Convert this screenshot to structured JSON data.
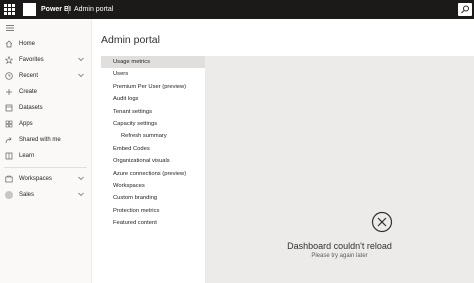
{
  "header": {
    "app_name": "Power BI",
    "breadcrumb": "Admin portal"
  },
  "nav": {
    "items": [
      {
        "label": "Home",
        "icon": "home-icon"
      },
      {
        "label": "Favorites",
        "icon": "star-icon",
        "chevron": true
      },
      {
        "label": "Recent",
        "icon": "clock-icon",
        "chevron": true
      },
      {
        "label": "Create",
        "icon": "plus-icon"
      },
      {
        "label": "Datasets",
        "icon": "database-icon"
      },
      {
        "label": "Apps",
        "icon": "apps-icon"
      },
      {
        "label": "Shared with me",
        "icon": "share-icon"
      },
      {
        "label": "Learn",
        "icon": "book-icon"
      }
    ],
    "workspaces_label": "Workspaces",
    "current_workspace_label": "Sales"
  },
  "main": {
    "title": "Admin portal",
    "settings": [
      "Usage metrics",
      "Users",
      "Premium Per User (preview)",
      "Audit logs",
      "Tenant settings",
      "Capacity settings",
      "Refresh summary",
      "Embed Codes",
      "Organizational visuals",
      "Azure connections (preview)",
      "Workspaces",
      "Custom branding",
      "Protection metrics",
      "Featured content"
    ],
    "selected_setting": "Usage metrics"
  },
  "error": {
    "title": "Dashboard couldn't reload",
    "subtitle": "Please try again later",
    "icon": "error-circle-icon"
  },
  "colors": {
    "topbar": "#1b1a19",
    "panel": "#edebe9",
    "selected": "#e1dfdd"
  }
}
